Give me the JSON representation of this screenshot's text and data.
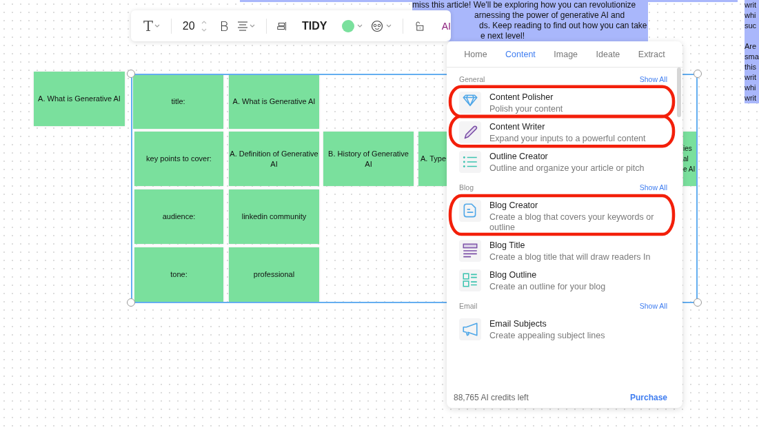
{
  "highlighted_note": {
    "lines": [
      "miss this article! We'll be exploring how you can revolutionize",
      "arnessing the power of generative AI and",
      "ds. Keep reading to find out how you can take",
      "e next level!"
    ]
  },
  "side_note": {
    "paragraphs": [
      [
        "writ",
        "whi",
        "suc"
      ],
      [
        "Are",
        "sma",
        "this",
        "writ",
        "whi",
        "writ"
      ]
    ]
  },
  "toolbar": {
    "text_glyph": "T",
    "font_size": "20",
    "bold_glyph": "B",
    "tidy_label": "TIDY",
    "color": "#7ae09d",
    "ai_label": "AI"
  },
  "floating_card": {
    "text": "A. What is Generative AI"
  },
  "table": {
    "selected": true,
    "rows": [
      [
        {
          "text": "title:",
          "clipped": false
        },
        {
          "text": "A. What is Generative AI",
          "clipped": false
        }
      ],
      [
        {
          "text": "key points to cover:",
          "clipped": false
        },
        {
          "text": "A. Definition of Generative AI",
          "clipped": false
        },
        {
          "text": "B. History of Generative AI",
          "clipped": false
        },
        {
          "text": "A. Type",
          "clipped": true
        },
        {
          "text": "ies\nal\ne AI",
          "clipped": true
        }
      ],
      [
        {
          "text": "audience:",
          "clipped": false
        },
        {
          "text": "linkedin community",
          "clipped": false
        }
      ],
      [
        {
          "text": "tone:",
          "clipped": false
        },
        {
          "text": "professional",
          "clipped": false
        }
      ]
    ]
  },
  "ai_panel": {
    "tabs": [
      {
        "label": "Home",
        "selected": false
      },
      {
        "label": "Content",
        "selected": true
      },
      {
        "label": "Image",
        "selected": false
      },
      {
        "label": "Ideate",
        "selected": false
      },
      {
        "label": "Extract",
        "selected": false
      }
    ],
    "sections": [
      {
        "title": "General",
        "action": "Show All",
        "items": [
          {
            "kind": "diamond",
            "title": "Content Polisher",
            "description": "Polish your content",
            "circled": true
          },
          {
            "kind": "pencil",
            "title": "Content Writer",
            "description": "Expand your inputs to a powerful content",
            "circled": true
          },
          {
            "kind": "list",
            "title": "Outline Creator",
            "description": "Outline and organize your article or pitch",
            "circled": false
          }
        ]
      },
      {
        "title": "Blog",
        "action": "Show All",
        "items": [
          {
            "kind": "blog",
            "title": "Blog Creator",
            "description": "Create a blog that covers your keywords or outline",
            "circled": true
          },
          {
            "kind": "title",
            "title": "Blog Title",
            "description": "Create a blog title that will draw readers In",
            "circled": false
          },
          {
            "kind": "outline",
            "title": "Blog Outline",
            "description": "Create an outline for your blog",
            "circled": false
          }
        ]
      },
      {
        "title": "Email",
        "action": "Show All",
        "items": [
          {
            "kind": "megaphone",
            "title": "Email Subjects",
            "description": "Create appealing subject lines",
            "circled": false
          }
        ]
      }
    ],
    "credits": "88,765 AI credits left",
    "purchase": "Purchase"
  }
}
